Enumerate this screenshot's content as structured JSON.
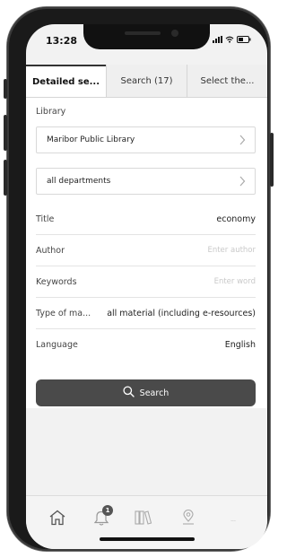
{
  "status_bar": {
    "time": "13:28"
  },
  "tabs": [
    {
      "label": "Detailed se...",
      "active": true
    },
    {
      "label": "Search (17)",
      "active": false
    },
    {
      "label": "Select the...",
      "active": false
    }
  ],
  "form": {
    "library_heading": "Library",
    "library_value": "Maribor Public Library",
    "department_value": "all departments",
    "fields": [
      {
        "label": "Title",
        "value": "economy",
        "placeholder": ""
      },
      {
        "label": "Author",
        "value": "",
        "placeholder": "Enter author"
      },
      {
        "label": "Keywords",
        "value": "",
        "placeholder": "Enter word"
      },
      {
        "label": "Type of ma...",
        "value": "all material (including e-resources)",
        "placeholder": ""
      },
      {
        "label": "Language",
        "value": "English",
        "placeholder": ""
      }
    ],
    "search_label": "Search"
  },
  "bottom_nav": {
    "items": [
      {
        "icon": "home-icon"
      },
      {
        "icon": "bell-icon",
        "badge": "1"
      },
      {
        "icon": "books-icon"
      },
      {
        "icon": "location-pin-icon"
      },
      {
        "icon": "more-icon",
        "label": "..."
      }
    ]
  },
  "colors": {
    "button_bg": "#4a4a4a",
    "placeholder": "#c9c9c9",
    "text": "#222222"
  }
}
